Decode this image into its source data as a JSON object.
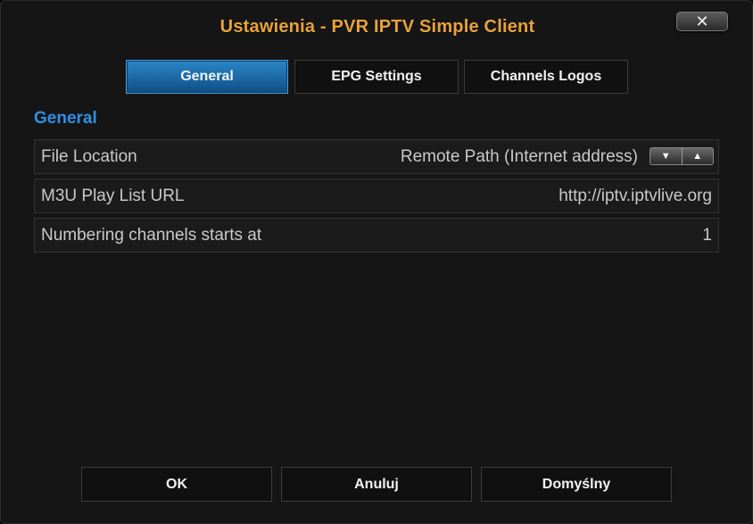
{
  "dialog": {
    "title": "Ustawienia - PVR IPTV Simple Client",
    "close_glyph": "✕"
  },
  "tabs": [
    {
      "label": "General",
      "active": true
    },
    {
      "label": "EPG Settings",
      "active": false
    },
    {
      "label": "Channels Logos",
      "active": false
    }
  ],
  "section": {
    "title": "General"
  },
  "settings": [
    {
      "label": "File Location",
      "value": "Remote Path (Internet address)",
      "control": "spinner"
    },
    {
      "label": "M3U Play List URL",
      "value": "http://iptv.iptvlive.org"
    },
    {
      "label": "Numbering channels starts at",
      "value": "1"
    }
  ],
  "spinner": {
    "down_icon": "triangle-down-icon",
    "up_icon": "triangle-up-icon"
  },
  "buttons": {
    "ok": "OK",
    "cancel": "Anuluj",
    "defaults": "Domyślny"
  },
  "colors": {
    "title": "#e8a33a",
    "section_title": "#2f8fe6",
    "active_tab": "#1a6aac"
  }
}
